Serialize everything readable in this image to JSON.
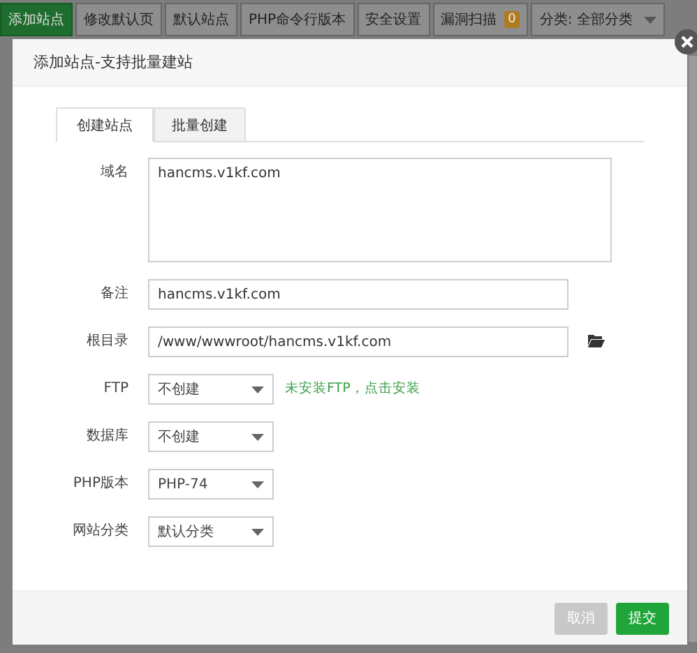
{
  "toolbar": [
    {
      "label": "添加站点",
      "kind": "button",
      "selected": true
    },
    {
      "label": "修改默认页",
      "kind": "button",
      "selected": false
    },
    {
      "label": "默认站点",
      "kind": "button",
      "selected": false
    },
    {
      "label": "PHP命令行版本",
      "kind": "button",
      "selected": false
    },
    {
      "label": "安全设置",
      "kind": "button",
      "selected": false
    },
    {
      "label": "漏洞扫描",
      "kind": "badge",
      "badge": "0",
      "selected": false
    },
    {
      "label": "分类: 全部分类",
      "kind": "dropdown",
      "selected": false
    }
  ],
  "modal": {
    "title": "添加站点-支持批量建站",
    "tabs": [
      {
        "label": "创建站点",
        "selected": true
      },
      {
        "label": "批量创建",
        "selected": false
      }
    ],
    "fields": [
      {
        "label": "域名",
        "kind": "textarea",
        "value": "hancms.v1kf.com"
      },
      {
        "label": "备注",
        "kind": "input",
        "value": "hancms.v1kf.com"
      },
      {
        "label": "根目录",
        "kind": "path",
        "value": "/www/wwwroot/hancms.v1kf.com"
      },
      {
        "label": "FTP",
        "kind": "select",
        "value": "不创建",
        "note": "未安装FTP，点击安装"
      },
      {
        "label": "数据库",
        "kind": "select",
        "value": "不创建"
      },
      {
        "label": "PHP版本",
        "kind": "select",
        "value": "PHP-74"
      },
      {
        "label": "网站分类",
        "kind": "select",
        "value": "默认分类"
      }
    ],
    "buttons": [
      {
        "label": "取消",
        "kind": "cancel"
      },
      {
        "label": "提交",
        "kind": "submit"
      }
    ]
  }
}
